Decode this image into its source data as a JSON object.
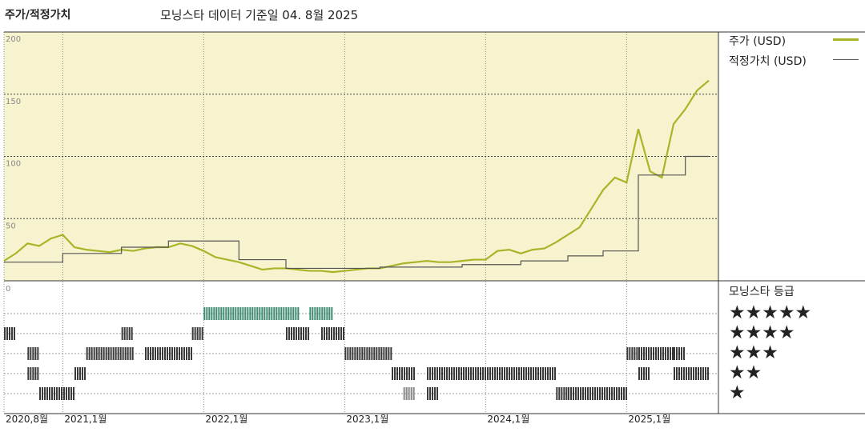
{
  "header": {
    "left_title": "주가/적정가치",
    "subtitle": "모닝스타 데이터 기준일 04. 8월 2025"
  },
  "legend": {
    "price_label": "주가 (USD)",
    "price_color": "#a8b528",
    "fair_label": "적정가치 (USD)",
    "fair_color": "#555555",
    "rating_title": "모닝스타 등급"
  },
  "colors": {
    "upper_bg": "#f7f3cf",
    "rating_bar": "#3a3a3a",
    "rating_bar_highlight": "#3f8a72",
    "rating_bar_gray": "#888888"
  },
  "chart_data": {
    "type": "line",
    "ylim": [
      0,
      200
    ],
    "yticks": [
      "200",
      "150",
      "100",
      "50",
      "0"
    ],
    "x_range": [
      "2020-08",
      "2025-08"
    ],
    "x_tick_labels": [
      "2020,8월",
      "2021,1월",
      "2022,1월",
      "2023,1월",
      "2024,1월",
      "2025,1월"
    ],
    "x_tick_dates": [
      "2020-08",
      "2021-01",
      "2022-01",
      "2023-01",
      "2024-01",
      "2025-01"
    ],
    "series": [
      {
        "name": "주가 (USD)",
        "points": [
          [
            "2020-08",
            16
          ],
          [
            "2020-09",
            22
          ],
          [
            "2020-10",
            30
          ],
          [
            "2020-11",
            28
          ],
          [
            "2020-12",
            34
          ],
          [
            "2021-01",
            37
          ],
          [
            "2021-02",
            27
          ],
          [
            "2021-03",
            25
          ],
          [
            "2021-04",
            24
          ],
          [
            "2021-05",
            23
          ],
          [
            "2021-06",
            25
          ],
          [
            "2021-07",
            24
          ],
          [
            "2021-08",
            26
          ],
          [
            "2021-09",
            27
          ],
          [
            "2021-10",
            27
          ],
          [
            "2021-11",
            30
          ],
          [
            "2021-12",
            28
          ],
          [
            "2022-01",
            24
          ],
          [
            "2022-02",
            19
          ],
          [
            "2022-03",
            17
          ],
          [
            "2022-04",
            15
          ],
          [
            "2022-05",
            12
          ],
          [
            "2022-06",
            9
          ],
          [
            "2022-07",
            10
          ],
          [
            "2022-08",
            10
          ],
          [
            "2022-09",
            9
          ],
          [
            "2022-10",
            8
          ],
          [
            "2022-11",
            8
          ],
          [
            "2022-12",
            7
          ],
          [
            "2023-01",
            8
          ],
          [
            "2023-02",
            9
          ],
          [
            "2023-03",
            10
          ],
          [
            "2023-04",
            10
          ],
          [
            "2023-05",
            12
          ],
          [
            "2023-06",
            14
          ],
          [
            "2023-07",
            15
          ],
          [
            "2023-08",
            16
          ],
          [
            "2023-09",
            15
          ],
          [
            "2023-10",
            15
          ],
          [
            "2023-11",
            16
          ],
          [
            "2023-12",
            17
          ],
          [
            "2024-01",
            17
          ],
          [
            "2024-02",
            24
          ],
          [
            "2024-03",
            25
          ],
          [
            "2024-04",
            22
          ],
          [
            "2024-05",
            25
          ],
          [
            "2024-06",
            26
          ],
          [
            "2024-07",
            31
          ],
          [
            "2024-08",
            37
          ],
          [
            "2024-09",
            43
          ],
          [
            "2024-10",
            58
          ],
          [
            "2024-11",
            73
          ],
          [
            "2024-12",
            83
          ],
          [
            "2025-01",
            79
          ],
          [
            "2025-02",
            122
          ],
          [
            "2025-03",
            88
          ],
          [
            "2025-04",
            83
          ],
          [
            "2025-05",
            126
          ],
          [
            "2025-06",
            138
          ],
          [
            "2025-07",
            153
          ],
          [
            "2025-08",
            161
          ]
        ]
      },
      {
        "name": "적정가치 (USD)",
        "points": [
          [
            "2020-08",
            15
          ],
          [
            "2020-12",
            15
          ],
          [
            "2021-01",
            22
          ],
          [
            "2021-05",
            22
          ],
          [
            "2021-06",
            27
          ],
          [
            "2021-09",
            27
          ],
          [
            "2021-10",
            32
          ],
          [
            "2022-03",
            32
          ],
          [
            "2022-04",
            17
          ],
          [
            "2022-07",
            17
          ],
          [
            "2022-08",
            10
          ],
          [
            "2022-12",
            10
          ],
          [
            "2023-01",
            10
          ],
          [
            "2023-03",
            10
          ],
          [
            "2023-04",
            11
          ],
          [
            "2023-10",
            11
          ],
          [
            "2023-11",
            13
          ],
          [
            "2024-03",
            13
          ],
          [
            "2024-04",
            16
          ],
          [
            "2024-07",
            16
          ],
          [
            "2024-08",
            20
          ],
          [
            "2024-10",
            20
          ],
          [
            "2024-11",
            24
          ],
          [
            "2025-01",
            24
          ],
          [
            "2025-02",
            85
          ],
          [
            "2025-05",
            85
          ],
          [
            "2025-06",
            100
          ],
          [
            "2025-08",
            100
          ]
        ]
      }
    ],
    "rating_rows": [
      "★★★★★",
      "★★★★",
      "★★★",
      "★★",
      "★"
    ],
    "rating_segments": [
      {
        "stars": 5,
        "from": "2022-01",
        "to": "2022-09",
        "color": "highlight"
      },
      {
        "stars": 5,
        "from": "2022-10",
        "to": "2022-12",
        "color": "highlight"
      },
      {
        "stars": 4,
        "from": "2020-08",
        "to": "2020-09"
      },
      {
        "stars": 4,
        "from": "2021-06",
        "to": "2021-07"
      },
      {
        "stars": 4,
        "from": "2021-12",
        "to": "2022-01"
      },
      {
        "stars": 4,
        "from": "2022-08",
        "to": "2022-10"
      },
      {
        "stars": 4,
        "from": "2022-11",
        "to": "2023-01"
      },
      {
        "stars": 3,
        "from": "2020-10",
        "to": "2020-11"
      },
      {
        "stars": 3,
        "from": "2021-03",
        "to": "2021-07"
      },
      {
        "stars": 3,
        "from": "2021-08",
        "to": "2021-12"
      },
      {
        "stars": 3,
        "from": "2023-01",
        "to": "2023-05"
      },
      {
        "stars": 3,
        "from": "2025-01",
        "to": "2025-02"
      },
      {
        "stars": 3,
        "from": "2025-02",
        "to": "2025-05"
      },
      {
        "stars": 3,
        "from": "2025-05",
        "to": "2025-06"
      },
      {
        "stars": 2,
        "from": "2020-10",
        "to": "2020-11"
      },
      {
        "stars": 2,
        "from": "2021-02",
        "to": "2021-03"
      },
      {
        "stars": 2,
        "from": "2023-05",
        "to": "2023-07"
      },
      {
        "stars": 2,
        "from": "2023-08",
        "to": "2024-05"
      },
      {
        "stars": 2,
        "from": "2024-05",
        "to": "2024-07"
      },
      {
        "stars": 2,
        "from": "2025-02",
        "to": "2025-03"
      },
      {
        "stars": 2,
        "from": "2025-05",
        "to": "2025-08"
      },
      {
        "stars": 1,
        "from": "2020-11",
        "to": "2021-02"
      },
      {
        "stars": 1,
        "from": "2023-06",
        "to": "2023-07",
        "color": "gray"
      },
      {
        "stars": 1,
        "from": "2023-08",
        "to": "2023-09"
      },
      {
        "stars": 1,
        "from": "2024-07",
        "to": "2024-08"
      },
      {
        "stars": 1,
        "from": "2024-08",
        "to": "2025-01"
      }
    ]
  }
}
